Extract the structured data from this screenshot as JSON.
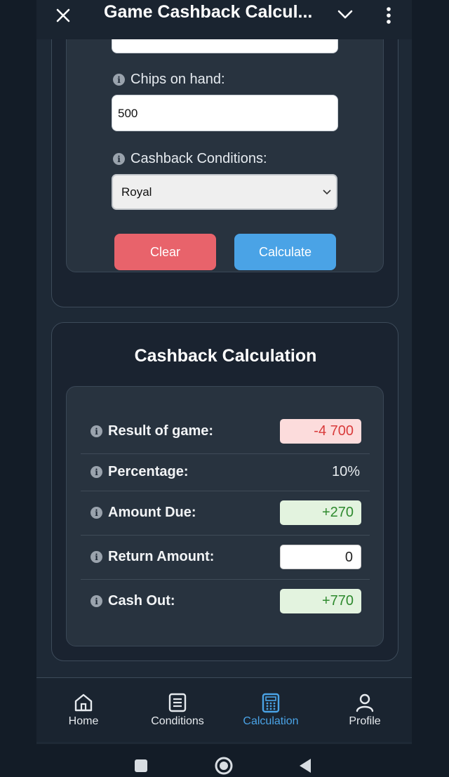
{
  "header": {
    "title": "Game Cashback Calcul..."
  },
  "form": {
    "chips_label": "Chips on hand:",
    "chips_value": "500",
    "conditions_label": "Cashback Conditions:",
    "conditions_value": "Royal",
    "clear_label": "Clear",
    "calculate_label": "Calculate"
  },
  "results": {
    "title": "Cashback Calculation",
    "rows": [
      {
        "label": "Result of game:",
        "value": "-4 700"
      },
      {
        "label": "Percentage:",
        "value": "10%"
      },
      {
        "label": "Amount Due:",
        "value": "+270"
      },
      {
        "label": "Return Amount:",
        "value": "0"
      },
      {
        "label": "Cash Out:",
        "value": "+770"
      }
    ]
  },
  "nav": {
    "items": [
      {
        "label": "Home",
        "icon": "home-icon"
      },
      {
        "label": "Conditions",
        "icon": "list-icon"
      },
      {
        "label": "Calculation",
        "icon": "calculator-icon"
      },
      {
        "label": "Profile",
        "icon": "profile-icon"
      }
    ],
    "active": "Calculation"
  },
  "colors": {
    "background": "#131c27",
    "accent": "#4aa3e6",
    "clear_button": "#e8636b",
    "negative": "#d93b3b",
    "positive": "#2e8a2e"
  }
}
